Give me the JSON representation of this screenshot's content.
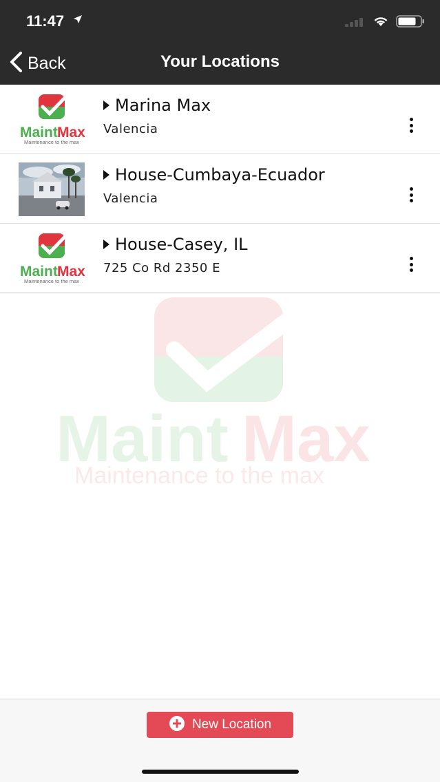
{
  "status_bar": {
    "time": "11:47"
  },
  "nav": {
    "back_label": "Back",
    "title": "Your Locations"
  },
  "locations": [
    {
      "name": "Marina Max",
      "subtitle": "Valencia",
      "thumbnail": "maintmax-logo"
    },
    {
      "name": "House-Cumbaya-Ecuador",
      "subtitle": "Valencia",
      "thumbnail": "house-photo"
    },
    {
      "name": "House-Casey, IL",
      "subtitle": "725 Co Rd 2350 E",
      "thumbnail": "maintmax-logo"
    }
  ],
  "logo": {
    "brand_maint": "Maint",
    "brand_max": "Max",
    "tagline": "Maintenance to the max"
  },
  "footer": {
    "new_location_label": "New Location"
  },
  "colors": {
    "bar": "#2b2b2b",
    "accent_red": "#e34a55",
    "logo_red": "#e0353f",
    "logo_green": "#4caf50"
  }
}
